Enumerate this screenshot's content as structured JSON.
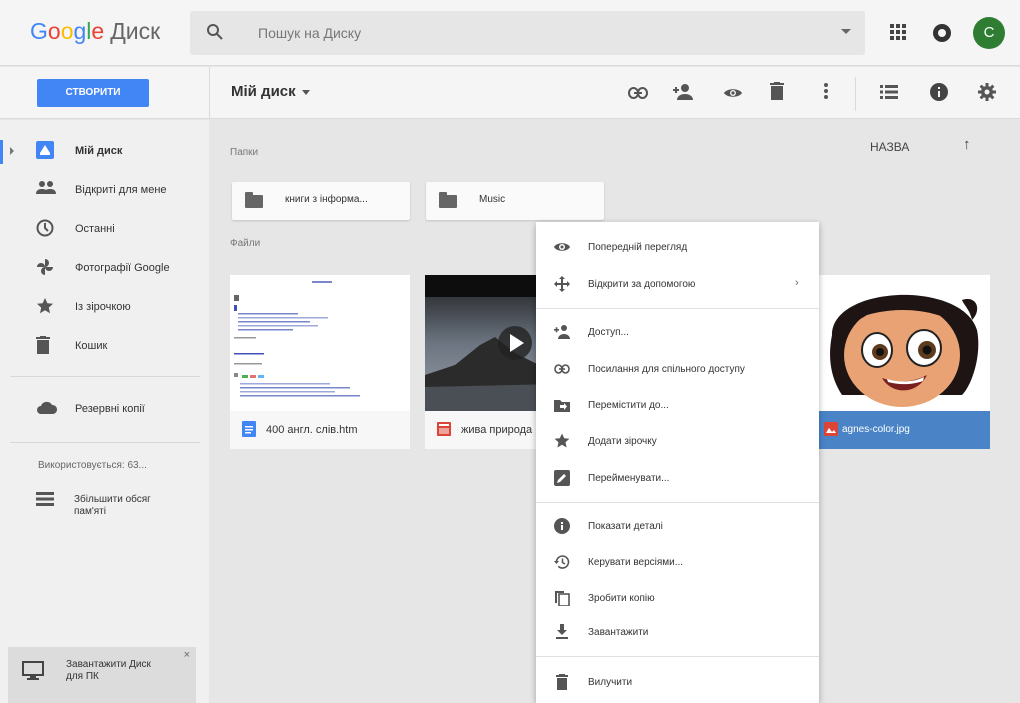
{
  "header": {
    "logo_letters": [
      "G",
      "o",
      "o",
      "g",
      "l",
      "e"
    ],
    "product": "Диск",
    "search_placeholder": "Пошук на Диску",
    "avatar_letter": "С",
    "avatar_color": "#2e7d32"
  },
  "toolbar": {
    "create_label": "СТВОРИТИ",
    "title": "Мій диск",
    "icons": [
      "link-icon",
      "add-person-icon",
      "preview-eye-icon",
      "trash-icon",
      "more-vert-icon",
      "list-view-icon",
      "info-icon",
      "settings-icon"
    ]
  },
  "sidebar": {
    "items": [
      {
        "label": "Мій диск",
        "icon": "drive-icon",
        "active": true
      },
      {
        "label": "Відкриті для мене",
        "icon": "shared-people-icon"
      },
      {
        "label": "Останні",
        "icon": "clock-icon"
      },
      {
        "label": "Фотографії Google",
        "icon": "photos-pinwheel-icon"
      },
      {
        "label": "Із зірочкою",
        "icon": "star-icon"
      },
      {
        "label": "Кошик",
        "icon": "trash-icon"
      }
    ],
    "backup_label": "Резервні копії",
    "storage_text": "Використовується: 63...",
    "upgrade_label": "Збільшити обсяг пам'яті",
    "download_label": "Завантажити Диск для ПК",
    "close_glyph": "×"
  },
  "main": {
    "sort_label": "НАЗВА",
    "sort_arrow": "↑",
    "folders_heading": "Папки",
    "files_heading": "Файли",
    "folders": [
      {
        "name": "книги з інформа..."
      },
      {
        "name": "Music"
      }
    ],
    "files": [
      {
        "name": "400 англ. слів.htm",
        "type": "document",
        "color": "#4285f4"
      },
      {
        "name": "жива природа",
        "type": "video",
        "color": "#db4437"
      },
      {
        "name": "agnes-color.jpg",
        "type": "image",
        "color": "#db4437",
        "selected": true
      }
    ]
  },
  "context_menu": {
    "items": [
      {
        "label": "Попередній перегляд",
        "icon": "eye-icon"
      },
      {
        "label": "Відкрити за допомогою",
        "icon": "open-with-icon",
        "submenu": true
      },
      {
        "label": "Доступ...",
        "icon": "add-person-icon"
      },
      {
        "label": "Посилання для спільного доступу",
        "icon": "link-icon"
      },
      {
        "label": "Перемістити до...",
        "icon": "move-folder-icon"
      },
      {
        "label": "Додати зірочку",
        "icon": "star-icon"
      },
      {
        "label": "Перейменувати...",
        "icon": "rename-icon"
      },
      {
        "label": "Показати деталі",
        "icon": "info-icon"
      },
      {
        "label": "Керувати версіями...",
        "icon": "history-icon"
      },
      {
        "label": "Зробити копію",
        "icon": "copy-icon"
      },
      {
        "label": "Завантажити",
        "icon": "download-icon"
      },
      {
        "label": "Вилучити",
        "icon": "trash-icon"
      }
    ],
    "submenu_arrow": "›"
  }
}
